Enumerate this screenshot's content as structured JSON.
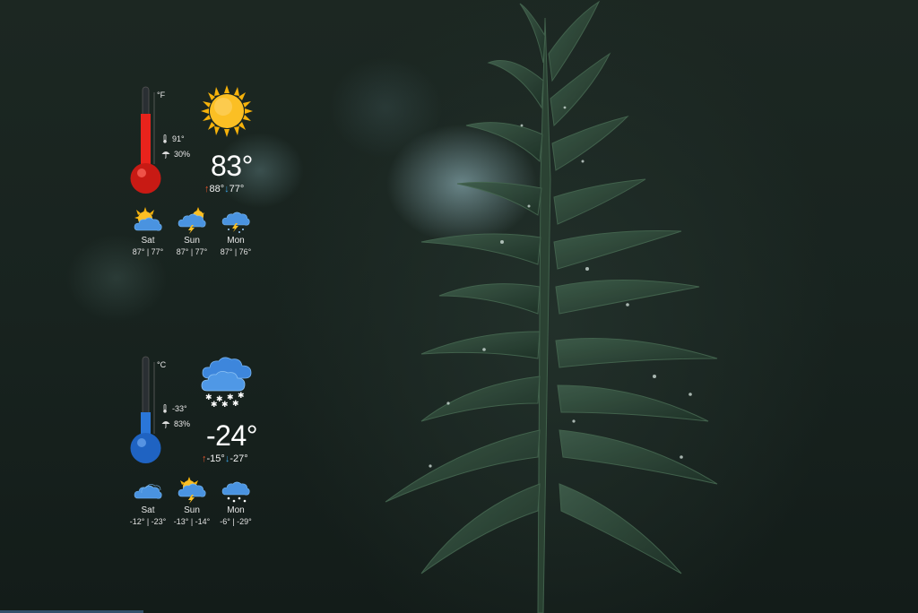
{
  "widget_f": {
    "unit": "°F",
    "feels_like": "91°",
    "precip": "30%",
    "condition_icon": "sun-icon",
    "current_temp": "83°",
    "high": "88°",
    "low": "77°",
    "thermometer_color": "#e8231c",
    "forecast": [
      {
        "day": "Sat",
        "range": "87° | 77°",
        "icon": "partly-cloudy-sun-icon"
      },
      {
        "day": "Sun",
        "range": "87° | 77°",
        "icon": "sun-thunderstorm-icon"
      },
      {
        "day": "Mon",
        "range": "87° | 76°",
        "icon": "thunderstorm-rain-icon"
      }
    ]
  },
  "widget_c": {
    "unit": "°C",
    "feels_like": "-33°",
    "precip": "83%",
    "condition_icon": "heavy-snow-icon",
    "current_temp": "-24°",
    "high": "-15°",
    "low": "-27°",
    "thermometer_color": "#2a76d8",
    "forecast": [
      {
        "day": "Sat",
        "range": "-12° | -23°",
        "icon": "cloudy-icon"
      },
      {
        "day": "Sun",
        "range": "-13° | -14°",
        "icon": "sun-thunderstorm-icon"
      },
      {
        "day": "Mon",
        "range": "-6° | -29°",
        "icon": "snow-cloud-icon"
      }
    ]
  }
}
